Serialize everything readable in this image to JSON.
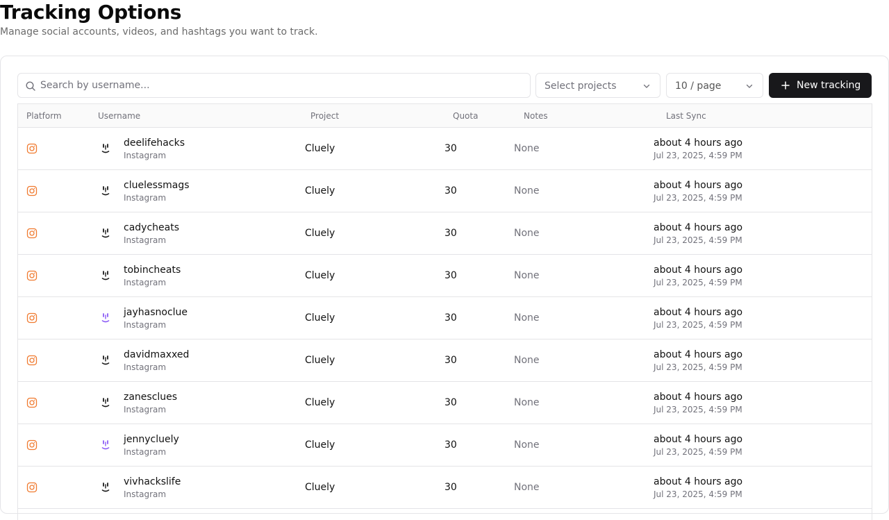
{
  "header": {
    "title": "Tracking Options",
    "subtitle": "Manage social accounts, videos, and hashtags you want to track."
  },
  "toolbar": {
    "search_placeholder": "Search by username...",
    "projects_select": "Select projects",
    "page_size_select": "10 / page",
    "new_button_label": "New tracking"
  },
  "table": {
    "columns": [
      "Platform",
      "Username",
      "Project",
      "Quota",
      "Notes",
      "Last Sync"
    ],
    "rows": [
      {
        "username": "deelifehacks",
        "platform": "Instagram",
        "avatar": "smiley-avatar",
        "project": "Cluely",
        "quota": "30",
        "notes": "None",
        "sync_relative": "about 4 hours ago",
        "sync_absolute": "Jul 23, 2025, 4:59 PM"
      },
      {
        "username": "cluelessmags",
        "platform": "Instagram",
        "avatar": "smiley-avatar",
        "project": "Cluely",
        "quota": "30",
        "notes": "None",
        "sync_relative": "about 4 hours ago",
        "sync_absolute": "Jul 23, 2025, 4:59 PM"
      },
      {
        "username": "cadycheats",
        "platform": "Instagram",
        "avatar": "smiley-avatar",
        "project": "Cluely",
        "quota": "30",
        "notes": "None",
        "sync_relative": "about 4 hours ago",
        "sync_absolute": "Jul 23, 2025, 4:59 PM"
      },
      {
        "username": "tobincheats",
        "platform": "Instagram",
        "avatar": "smiley-avatar",
        "project": "Cluely",
        "quota": "30",
        "notes": "None",
        "sync_relative": "about 4 hours ago",
        "sync_absolute": "Jul 23, 2025, 4:59 PM"
      },
      {
        "username": "jayhasnoclue",
        "platform": "Instagram",
        "avatar": "purple-smiley-avatar",
        "project": "Cluely",
        "quota": "30",
        "notes": "None",
        "sync_relative": "about 4 hours ago",
        "sync_absolute": "Jul 23, 2025, 4:59 PM"
      },
      {
        "username": "davidmaxxed",
        "platform": "Instagram",
        "avatar": "smiley-avatar",
        "project": "Cluely",
        "quota": "30",
        "notes": "None",
        "sync_relative": "about 4 hours ago",
        "sync_absolute": "Jul 23, 2025, 4:59 PM"
      },
      {
        "username": "zanesclues",
        "platform": "Instagram",
        "avatar": "smiley-avatar",
        "project": "Cluely",
        "quota": "30",
        "notes": "None",
        "sync_relative": "about 4 hours ago",
        "sync_absolute": "Jul 23, 2025, 4:59 PM"
      },
      {
        "username": "jennycluely",
        "platform": "Instagram",
        "avatar": "purple-smiley-avatar",
        "project": "Cluely",
        "quota": "30",
        "notes": "None",
        "sync_relative": "about 4 hours ago",
        "sync_absolute": "Jul 23, 2025, 4:59 PM"
      },
      {
        "username": "vivhackslife",
        "platform": "Instagram",
        "avatar": "smiley-avatar",
        "project": "Cluely",
        "quota": "30",
        "notes": "None",
        "sync_relative": "about 4 hours ago",
        "sync_absolute": "Jul 23, 2025, 4:59 PM"
      }
    ]
  },
  "colors": {
    "instagram_icon": "#f07a2f",
    "avatar_dark": "#1a1a1a",
    "avatar_purple": "#8b5cf6",
    "primary_button": "#18181b"
  }
}
